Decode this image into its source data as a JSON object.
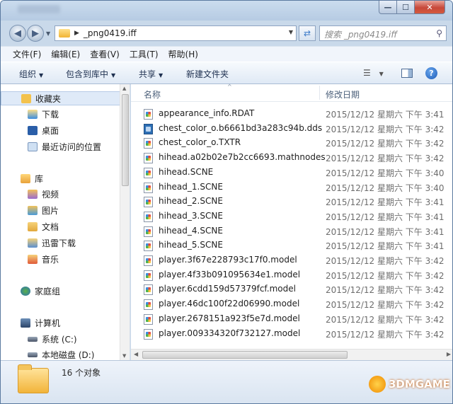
{
  "window": {
    "title": ""
  },
  "address": {
    "path": "_png0419.iff",
    "search_placeholder": "搜索 _png0419.iff"
  },
  "menu": [
    "文件(F)",
    "编辑(E)",
    "查看(V)",
    "工具(T)",
    "帮助(H)"
  ],
  "toolbar": {
    "organize": "组织",
    "include": "包含到库中",
    "share": "共享",
    "new_folder": "新建文件夹"
  },
  "nav": {
    "favorites": "收藏夹",
    "downloads": "下载",
    "desktop": "桌面",
    "recent": "最近访问的位置",
    "libraries": "库",
    "videos": "视频",
    "pictures": "图片",
    "documents": "文档",
    "thunder": "迅雷下载",
    "music": "音乐",
    "homegroup": "家庭组",
    "computer": "计算机",
    "drive_c": "系统 (C:)",
    "drive_d": "本地磁盘 (D:)"
  },
  "columns": {
    "name": "名称",
    "date": "修改日期"
  },
  "files": [
    {
      "name": "appearance_info.RDAT",
      "date": "2015/12/12 星期六 下午 3:41"
    },
    {
      "name": "chest_color_o.b6661bd3a283c94b.dds",
      "date": "2015/12/12 星期六 下午 3:42"
    },
    {
      "name": "chest_color_o.TXTR",
      "date": "2015/12/12 星期六 下午 3:42"
    },
    {
      "name": "hihead.a02b02e7b2cc6693.mathnodes",
      "date": "2015/12/12 星期六 下午 3:42"
    },
    {
      "name": "hihead.SCNE",
      "date": "2015/12/12 星期六 下午 3:40"
    },
    {
      "name": "hihead_1.SCNE",
      "date": "2015/12/12 星期六 下午 3:40"
    },
    {
      "name": "hihead_2.SCNE",
      "date": "2015/12/12 星期六 下午 3:41"
    },
    {
      "name": "hihead_3.SCNE",
      "date": "2015/12/12 星期六 下午 3:41"
    },
    {
      "name": "hihead_4.SCNE",
      "date": "2015/12/12 星期六 下午 3:41"
    },
    {
      "name": "hihead_5.SCNE",
      "date": "2015/12/12 星期六 下午 3:41"
    },
    {
      "name": "player.3f67e228793c17f0.model",
      "date": "2015/12/12 星期六 下午 3:42"
    },
    {
      "name": "player.4f33b091095634e1.model",
      "date": "2015/12/12 星期六 下午 3:42"
    },
    {
      "name": "player.6cdd159d57379fcf.model",
      "date": "2015/12/12 星期六 下午 3:42"
    },
    {
      "name": "player.46dc100f22d06990.model",
      "date": "2015/12/12 星期六 下午 3:42"
    },
    {
      "name": "player.2678151a923f5e7d.model",
      "date": "2015/12/12 星期六 下午 3:42"
    },
    {
      "name": "player.009334320f732127.model",
      "date": "2015/12/12 星期六 下午 3:42"
    }
  ],
  "status": {
    "count": "16 个对象"
  },
  "watermark": {
    "text": "3DMGAME"
  },
  "colors": {
    "accent": "#3c7ac9",
    "selection": "#dfeaf8"
  }
}
